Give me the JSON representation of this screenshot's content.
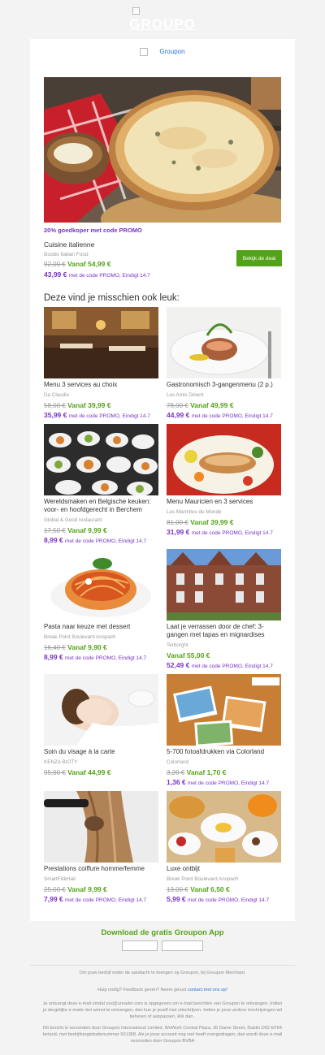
{
  "header": {
    "logo_text": "GROUPO",
    "alt_logo": "Groupon"
  },
  "featured": {
    "promo": "20% goedkoper met code PROMO",
    "title": "Cuisine italienne",
    "merchant": "Boobo Italian Food",
    "old_price": "92,00 €",
    "new_price": "Vanaf 54,99 €",
    "promo_price": "43,99 €",
    "promo_text": "met de code PROMO, Eindigt 14.7",
    "button": "Bekijk de deal"
  },
  "section_title": "Deze vind je misschien ook leuk:",
  "deals": [
    {
      "title": "Menu 3 services au choix",
      "merchant": "Da Claudio",
      "old": "58,00 €",
      "price": "Vanaf 39,99 €",
      "promo_price": "35,99 €",
      "promo_text": "met de code PROMO, Eindigt 14.7"
    },
    {
      "title": "Gastronomisch 3-gangenmenu (2 p.)",
      "merchant": "Les Amis Dinent",
      "old": "78,00 €",
      "price": "Vanaf 49,99 €",
      "promo_price": "44,99 €",
      "promo_text": "met de code PROMO, Eindigt 14.7"
    },
    {
      "title": "Wereldsmaken en Belgische keuken: voor- en hoofdgerecht in Berchem",
      "merchant": "Global & Good restaurant",
      "old": "17,50 €",
      "price": "Vanaf 9,99 €",
      "promo_price": "8,99 €",
      "promo_text": "met de code PROMO, Eindigt 14.7"
    },
    {
      "title": "Menu Mauricien en 3 services",
      "merchant": "Les Marmites du Monde",
      "old": "81,00 €",
      "price": "Vanaf 39,99 €",
      "promo_price": "31,99 €",
      "promo_text": "met de code PROMO, Eindigt 14.7"
    },
    {
      "title": "Pasta naar keuze met dessert",
      "merchant": "Break Point Boulevard Anspach",
      "old": "16,40 €",
      "price": "Vanaf 9,90 €",
      "promo_price": "8,99 €",
      "promo_text": "met de code PROMO, Eindigt 14.7"
    },
    {
      "title": "Laat je verrassen door de chef: 3-gangen met tapas en mignardises",
      "merchant": "Terborght",
      "old": "",
      "price": "Vanaf 55,00 €",
      "promo_price": "52,49 €",
      "promo_text": "met de code PROMO, Eindigt 14.7"
    },
    {
      "title": "Soin du visage à la carte",
      "merchant": "KENZA BIOTY",
      "old": "95,00 €",
      "price": "Vanaf 44,99 €",
      "promo_price": "",
      "promo_text": ""
    },
    {
      "title": "5-700 fotoafdrukken via Colorland",
      "merchant": "Colorland",
      "old": "3,20 €",
      "price": "Vanaf 1,70 €",
      "promo_price": "1,36 €",
      "promo_text": "met de code PROMO, Eindigt 14.7"
    },
    {
      "title": "Prestations coiffure homme/femme",
      "merchant": "SmartFit&Hair",
      "old": "25,00 €",
      "price": "Vanaf 9,99 €",
      "promo_price": "7,99 €",
      "promo_text": "met de code PROMO, Eindigt 14.7"
    },
    {
      "title": "Luxe ontbijt",
      "merchant": "Break Point Boulevard Anspach",
      "old": "13,00 €",
      "price": "Vanaf 6,50 €",
      "promo_price": "5,99 €",
      "promo_text": "met de code PROMO, Eindigt 14.7"
    }
  ],
  "app": {
    "title": "Download de gratis Groupon App"
  },
  "footer": {
    "line1": "Om jouw bedrijf onder de aandacht te brengen op Groupon, bij Groupon Merchant.",
    "help": "Hulp nodig? Feedback geven? Neem gerust",
    "help_link": "contact met ons op!",
    "p1": "Je ontvangt deze e-mail omdat xxx@ureader.com is opgegeven om e-mail berichten van Groupon te ontvangen. Indien je dergelijke e-mails niet wenst te ontvangen, dan kun je jezelf met uitschrijven. Indien je jouw andere inschrijvingen wil beheren of aanpassen, klik dan .",
    "p2": "Dit bericht is verzonden door Groupon International Limited, WeWork Central Plaza, 36 Dame Street, Dublin D02 EF64 Ierland, met bedrijfsregistratienummer 501358. Als je jouw account nog niet heeft overgedragen, dan wordt deze e-mail verzonden door Groupon BVBA"
  }
}
